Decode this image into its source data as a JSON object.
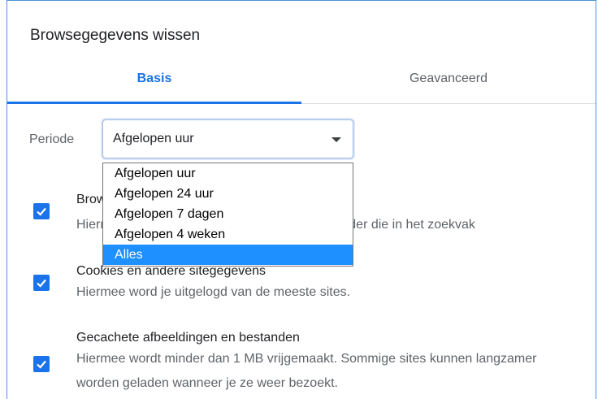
{
  "dialog": {
    "title": "Browsegegevens wissen",
    "tabs": [
      {
        "label": "Basis",
        "active": true
      },
      {
        "label": "Geavanceerd",
        "active": false
      }
    ],
    "period": {
      "label": "Periode",
      "value": "Afgelopen uur",
      "options": [
        {
          "label": "Afgelopen uur",
          "selected": false
        },
        {
          "label": "Afgelopen 24 uur",
          "selected": false
        },
        {
          "label": "Afgelopen 7 dagen",
          "selected": false
        },
        {
          "label": "Afgelopen 4 weken",
          "selected": false
        },
        {
          "label": "Alles",
          "selected": true
        }
      ]
    },
    "items": [
      {
        "title": "Browsegeschiedenis",
        "description": "Hiermee wordt de geschiedenis gewist, waaronder die in het zoekvak",
        "checked": true
      },
      {
        "title": "Cookies en andere sitegegevens",
        "description": "Hiermee word je uitgelogd van de meeste sites.",
        "checked": true
      },
      {
        "title": "Gecachete afbeeldingen en bestanden",
        "description": "Hiermee wordt minder dan 1 MB vrijgemaakt. Sommige sites kunnen langzamer worden geladen wanneer je ze weer bezoekt.",
        "checked": true
      }
    ]
  },
  "colors": {
    "accent": "#1a73e8",
    "selected_option": "#1e90ff",
    "muted_text": "#5f6368"
  }
}
